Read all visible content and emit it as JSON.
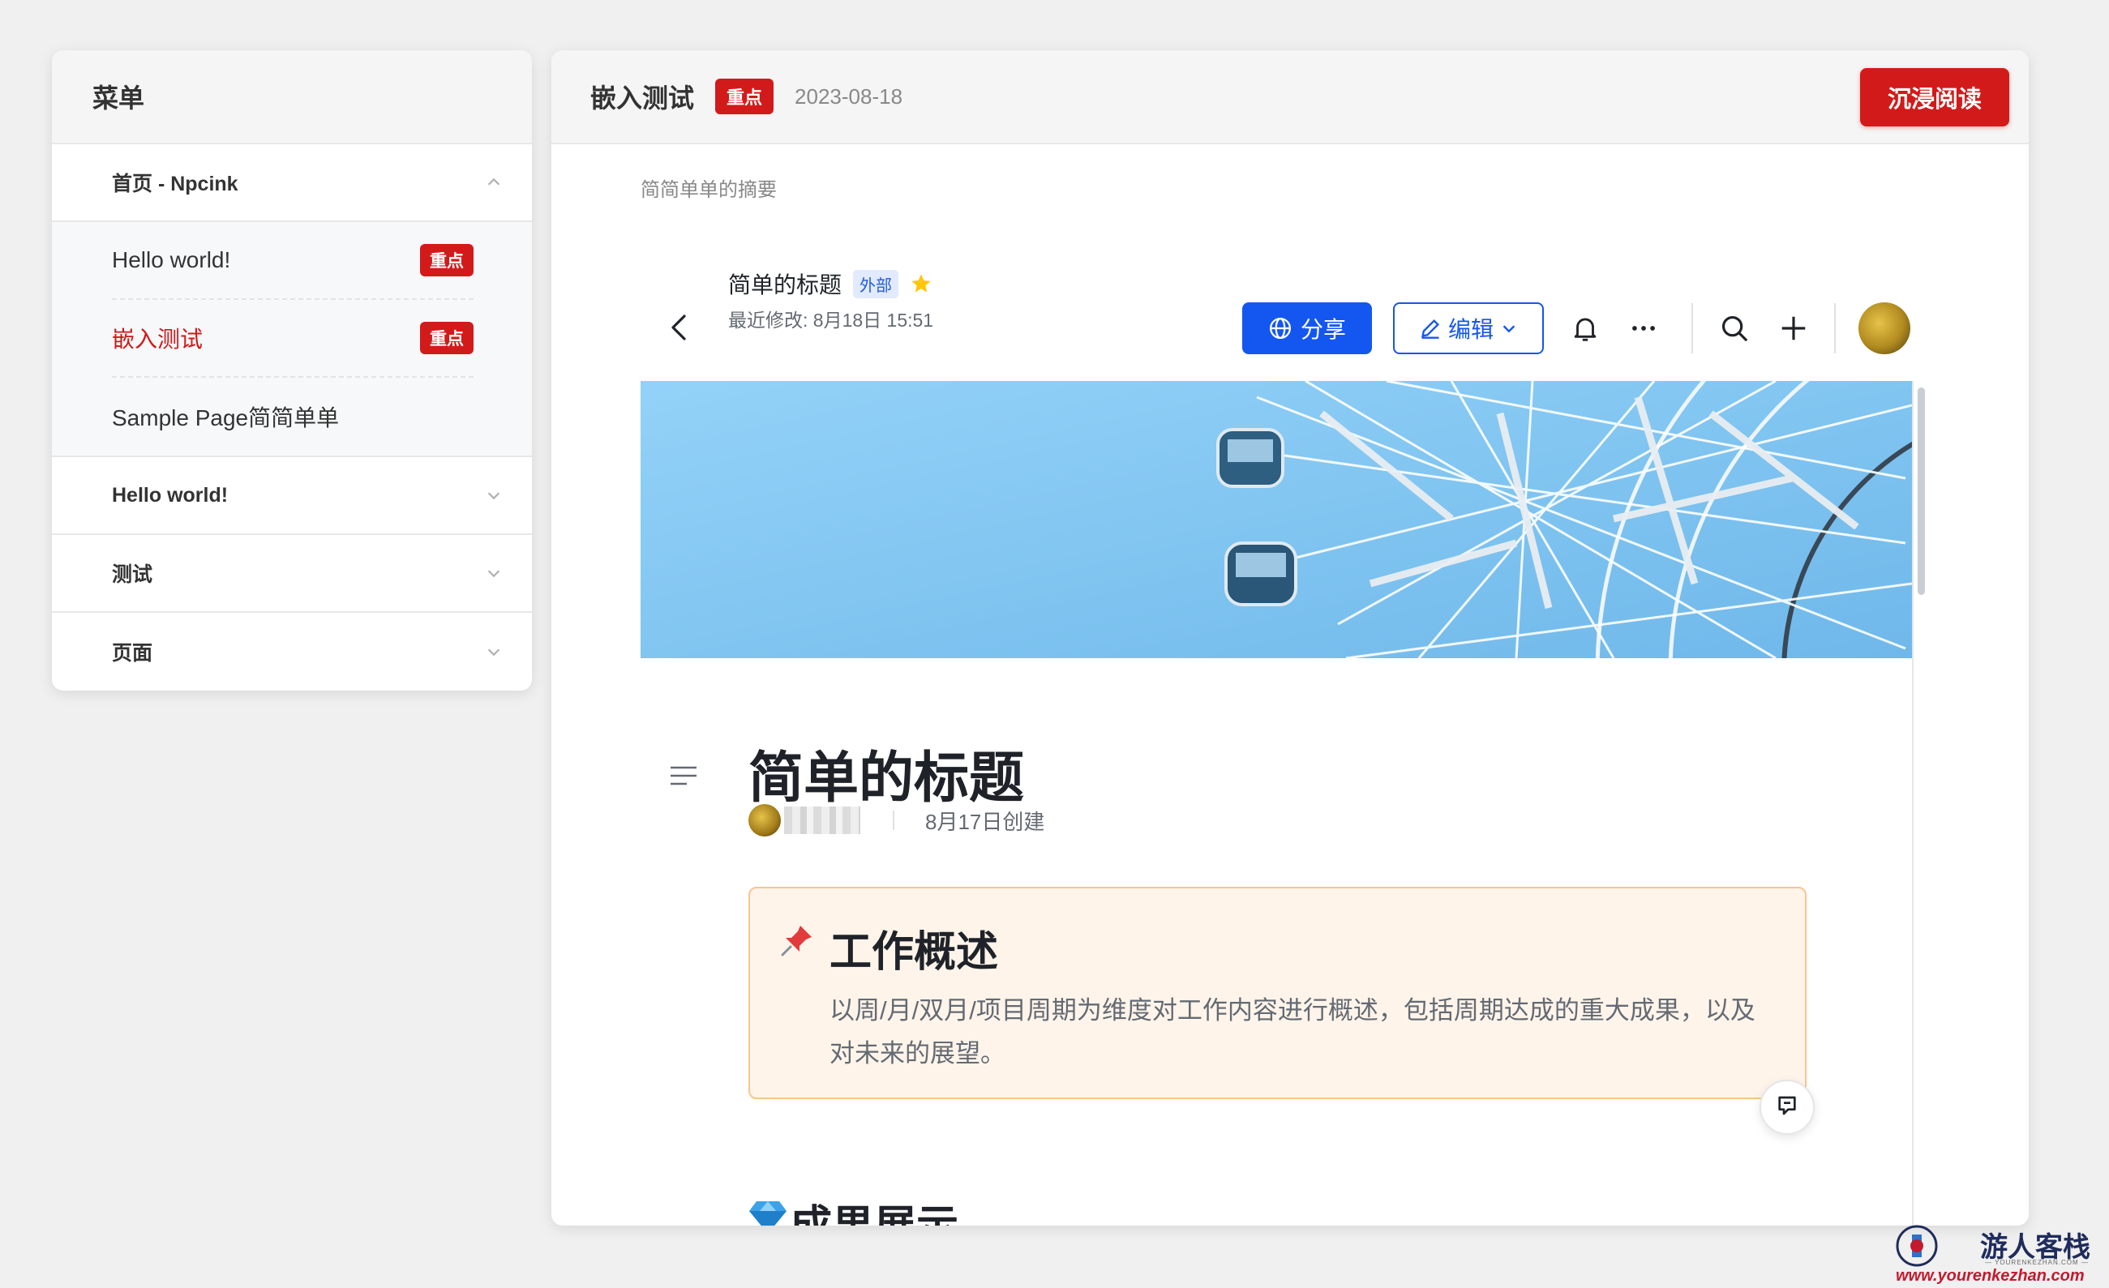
{
  "sidebar": {
    "title": "菜单",
    "groups": [
      {
        "label": "首页 - Npcink",
        "expanded": true
      },
      {
        "label": "Hello world!",
        "expanded": false
      },
      {
        "label": "测试",
        "expanded": false
      },
      {
        "label": "页面",
        "expanded": false
      }
    ],
    "sub_items": [
      {
        "label": "Hello world!",
        "badge": "重点"
      },
      {
        "label": "嵌入测试",
        "badge": "重点",
        "active": true
      },
      {
        "label": "Sample Page简简单单"
      }
    ]
  },
  "main": {
    "title": "嵌入测试",
    "badge": "重点",
    "date": "2023-08-18",
    "immersive_label": "沉浸阅读",
    "summary": "简简单单的摘要"
  },
  "doc": {
    "name": "简单的标题",
    "tag": "外部",
    "modified": "最近修改: 8月18日 15:51",
    "share_label": "分享",
    "edit_label": "编辑",
    "heading": "简单的标题",
    "created": "8月17日创建",
    "callout": {
      "title": "工作概述",
      "body": "以周/月/双月/项目周期为维度对工作内容进行概述，包括周期达成的重大成果，以及对未来的展望。"
    },
    "section_title": "成果展示"
  },
  "watermark": {
    "name": "游人客栈",
    "small": "— YOURENKEZHAN.COM —",
    "url": "www.yourenkezhan.com"
  },
  "colors": {
    "accent_red": "#d31a1a",
    "accent_blue": "#1456f0",
    "callout_bg": "#fef4ea",
    "callout_border": "#f8c58e",
    "sky": "#86c8f2"
  },
  "icons": [
    "chevron-up-icon",
    "chevron-down-icon",
    "back-arrow-icon",
    "star-icon",
    "globe-icon",
    "pencil-icon",
    "bell-icon",
    "more-icon",
    "search-icon",
    "plus-icon",
    "toc-icon",
    "pushpin-icon",
    "comment-icon",
    "gem-icon"
  ]
}
